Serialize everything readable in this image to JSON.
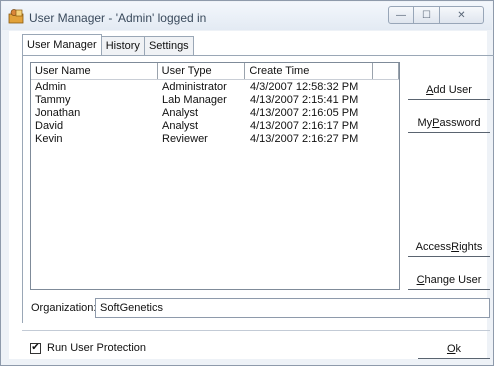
{
  "window": {
    "title": "User Manager - 'Admin' logged in"
  },
  "tabs": [
    {
      "label": "User Manager",
      "active": true
    },
    {
      "label": "History",
      "active": false
    },
    {
      "label": "Settings",
      "active": false
    }
  ],
  "table": {
    "columns": [
      "User Name",
      "User Type",
      "Create Time",
      ""
    ],
    "rows": [
      {
        "name": "Admin",
        "type": "Administrator",
        "created": "4/3/2007 12:58:32 PM"
      },
      {
        "name": "Tammy",
        "type": "Lab Manager",
        "created": "4/13/2007 2:15:41 PM"
      },
      {
        "name": "Jonathan",
        "type": "Analyst",
        "created": "4/13/2007 2:16:05 PM"
      },
      {
        "name": "David",
        "type": "Analyst",
        "created": "4/13/2007 2:16:17 PM"
      },
      {
        "name": "Kevin",
        "type": "Reviewer",
        "created": "4/13/2007 2:16:27 PM"
      }
    ]
  },
  "buttons": {
    "add_user": {
      "before": "",
      "key": "A",
      "after": "dd User"
    },
    "my_password": {
      "before": "My ",
      "key": "P",
      "after": "assword"
    },
    "access_rights": {
      "before": "Access ",
      "key": "R",
      "after": "ights"
    },
    "change_user": {
      "before": "",
      "key": "C",
      "after": "hange User"
    },
    "ok": {
      "before": "",
      "key": "O",
      "after": "k"
    }
  },
  "organization": {
    "label": "Organization:",
    "value": "SoftGenetics"
  },
  "protection": {
    "label": "Run User Protection",
    "checked": true,
    "check_glyph": "✔"
  },
  "controls": {
    "minimize": "—",
    "maximize": "☐",
    "close": "✕"
  }
}
